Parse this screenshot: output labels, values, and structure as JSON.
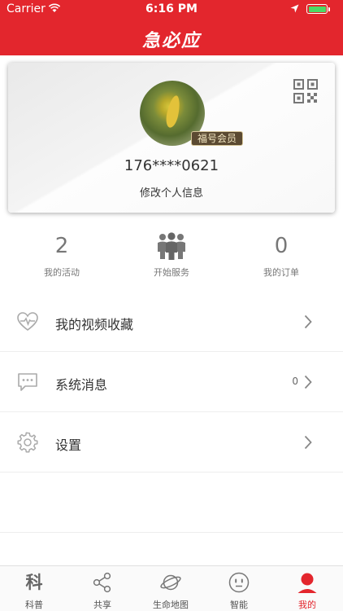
{
  "status_bar": {
    "carrier": "Carrier",
    "time": "6:16 PM"
  },
  "header": {
    "logo_text": "急必应"
  },
  "profile": {
    "member_badge": "福号会员",
    "phone": "176****0621",
    "edit_label": "修改个人信息"
  },
  "stats": [
    {
      "value": "2",
      "label": "我的活动"
    },
    {
      "label": "开始服务"
    },
    {
      "value": "0",
      "label": "我的订单"
    }
  ],
  "menu": [
    {
      "label": "我的视频收藏",
      "icon": "heart-pulse-icon"
    },
    {
      "label": "系统消息",
      "count": "0",
      "icon": "message-icon"
    },
    {
      "label": "设置",
      "icon": "gear-icon"
    }
  ],
  "tabs": [
    {
      "label": "科普",
      "icon_text": "科"
    },
    {
      "label": "共享"
    },
    {
      "label": "生命地图"
    },
    {
      "label": "智能"
    },
    {
      "label": "我的"
    }
  ],
  "colors": {
    "brand_red": "#e3262d",
    "text": "#333333",
    "muted": "#777777"
  }
}
